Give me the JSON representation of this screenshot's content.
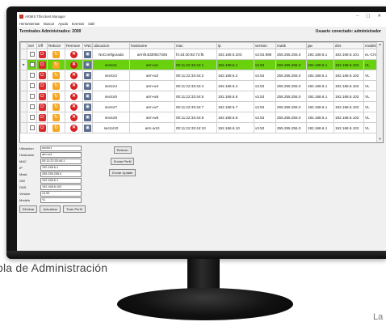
{
  "window": {
    "title": "ARMIS Thinclient Manager",
    "controls": [
      "–",
      "▢",
      "✕"
    ]
  },
  "menu": [
    "Herramientas",
    "Buscar",
    "Ayuda",
    "Eventos",
    "Salir"
  ],
  "info": {
    "terminals": "Terminales Administrados: 2000",
    "user": "Usuario conectado: administrador"
  },
  "table": {
    "columns": [
      "",
      "Sel",
      "Off",
      "Reboot",
      "Remove",
      "VNC",
      "ubicacion",
      "hostname",
      "mac",
      "ip",
      "version",
      "mask",
      "gw",
      "dns",
      "modelo"
    ],
    "rows": [
      {
        "ubicacion": "NoConfigurada",
        "hostname": "armf44d30927265",
        "mac": "f4:4d:30:92:72:f5",
        "ip": "192.168.6.203",
        "version": "v3.53.988",
        "mask": "255.255.255.0",
        "gw": "192.168.6.1",
        "dns": "192.168.6.101",
        "modelo": "eL-C/V"
      },
      {
        "ubicacion": "sector1",
        "hostname": "arm-w1",
        "mac": "00:11:22:33:44:1",
        "ip": "192.168.6.1",
        "version": "v3.53",
        "mask": "255.255.255.0",
        "gw": "192.168.6.1",
        "dns": "192.168.6.102",
        "modelo": "VL"
      },
      {
        "ubicacion": "sector2",
        "hostname": "arm-w2",
        "mac": "00:11:22:33:44:2",
        "ip": "192.168.6.2",
        "version": "v3.53",
        "mask": "255.255.255.0",
        "gw": "192.168.6.1",
        "dns": "192.168.6.102",
        "modelo": "VL"
      },
      {
        "ubicacion": "sector4",
        "hostname": "arm-w4",
        "mac": "00:11:22:33:44:4",
        "ip": "192.168.6.4",
        "version": "v3.53",
        "mask": "255.255.255.0",
        "gw": "192.168.6.1",
        "dns": "192.168.6.102",
        "modelo": "VL"
      },
      {
        "ubicacion": "sector5",
        "hostname": "arm-w5",
        "mac": "00:11:22:33:44:5",
        "ip": "192.168.6.5",
        "version": "v3.53",
        "mask": "255.255.255.0",
        "gw": "192.168.6.1",
        "dns": "192.168.6.102",
        "modelo": "VL"
      },
      {
        "ubicacion": "sector7",
        "hostname": "arm-w7",
        "mac": "00:11:22:33:44:7",
        "ip": "192.168.6.7",
        "version": "v3.53",
        "mask": "255.255.255.0",
        "gw": "192.168.6.1",
        "dns": "192.168.6.102",
        "modelo": "VL"
      },
      {
        "ubicacion": "sector8",
        "hostname": "arm-w8",
        "mac": "00:11:22:33:44:8",
        "ip": "192.168.6.8",
        "version": "v3.53",
        "mask": "255.255.255.0",
        "gw": "192.168.6.1",
        "dns": "192.168.6.102",
        "modelo": "VL"
      },
      {
        "ubicacion": "sector10",
        "hostname": "arm-w10",
        "mac": "00:11:22:33:44:10",
        "ip": "192.168.6.10",
        "version": "v3.53",
        "mask": "255.255.255.0",
        "gw": "192.168.6.1",
        "dns": "192.168.6.102",
        "modelo": "VL"
      }
    ],
    "selected_index": 1,
    "icons": {
      "off": "power-icon",
      "reboot": "reboot-icon",
      "remove": "remove-icon",
      "vnc": "vnc-icon"
    },
    "colors": {
      "selected_row": "#6ad10e",
      "off": "#d92b2b",
      "reboot": "#f5a623",
      "remove": "#d91f1f"
    }
  },
  "form": {
    "fields": [
      {
        "label": "Ubicacion",
        "value": "sector1"
      },
      {
        "label": "Hostname",
        "value": "arm-w1"
      },
      {
        "label": "MAC",
        "value": "00:11:22:33:44:1"
      },
      {
        "label": "IP",
        "value": "192.168.6.1"
      },
      {
        "label": "Mask",
        "value": "255.255.255.0"
      },
      {
        "label": "GW",
        "value": "192.168.6.1"
      },
      {
        "label": "DNS",
        "value": "192.168.6.102"
      },
      {
        "label": "Version",
        "value": "v3.53"
      },
      {
        "label": "Modelo",
        "value": "VL"
      }
    ],
    "buttons": [
      "Eliminar",
      "Actualizar",
      "Traer Perfil"
    ],
    "side_buttons": [
      "Refresh",
      "Enviar Perfil",
      "Enviar Update"
    ]
  },
  "caption": "ola de Administración",
  "corner_text": "La"
}
